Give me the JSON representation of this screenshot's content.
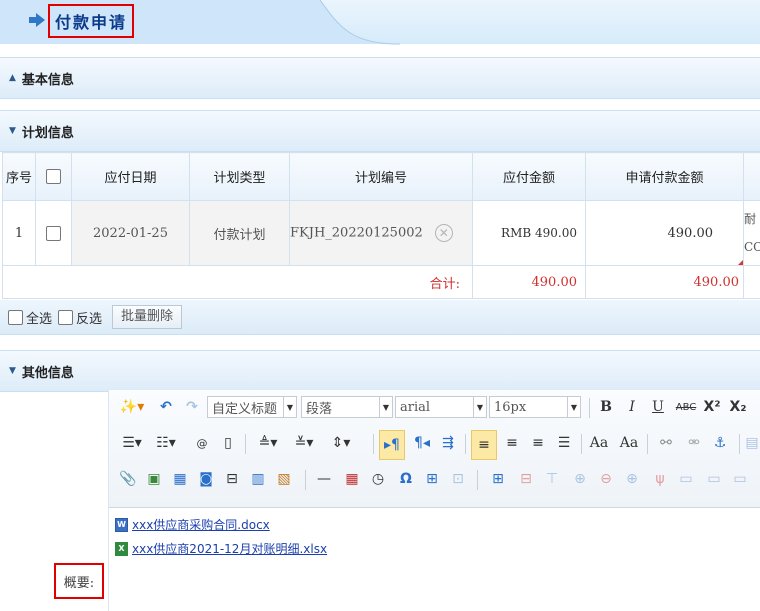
{
  "header": {
    "title": "付款申请"
  },
  "sections": {
    "basic": "基本信息",
    "plan": "计划信息",
    "other": "其他信息"
  },
  "table": {
    "headers": [
      "序号",
      "",
      "应付日期",
      "计划类型",
      "计划编号",
      "应付金额",
      "申请付款金额"
    ],
    "row": {
      "index": "1",
      "due_date": "2022-01-25",
      "plan_type": "付款计划",
      "plan_no": "FKJH_20220125002",
      "payable": "RMB 490.00",
      "apply_amount": "490.00",
      "cut_text_1": "耐",
      "cut_text_2": "CO"
    },
    "sum": {
      "label": "合计:",
      "payable": "490.00",
      "apply": "490.00"
    }
  },
  "select_bar": {
    "select_all": "全选",
    "invert": "反选",
    "batch_delete": "批量删除"
  },
  "editor": {
    "title_select": "自定义标题",
    "paragraph_select": "段落",
    "font_select": "arial",
    "size_select": "16px",
    "files": [
      "xxx供应商采购合同.docx",
      "xxx供应商2021-12月对账明细.xlsx"
    ]
  },
  "summary_label": "概要:",
  "colors": {
    "accent": "#0b3a8a",
    "highlight": "#e00000",
    "sum_text": "#d03030",
    "link": "#1a3fae"
  }
}
